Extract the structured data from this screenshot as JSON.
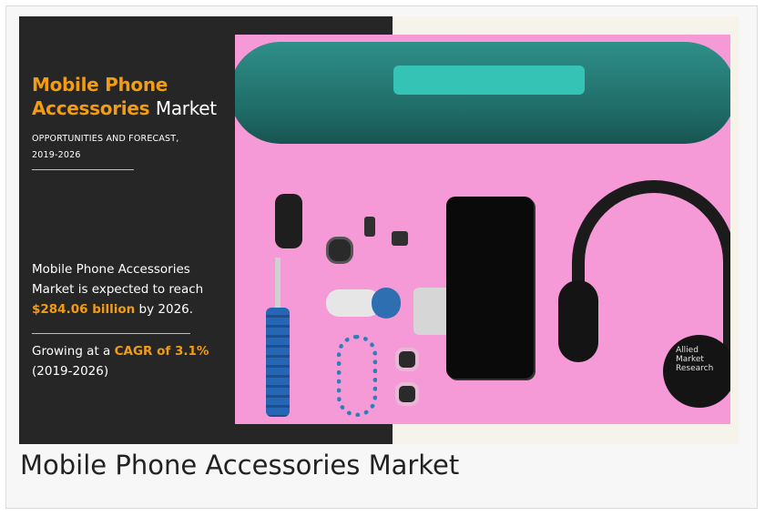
{
  "infographic": {
    "title_highlight_line1": "Mobile Phone",
    "title_highlight_line2": "Accessories",
    "title_plain": "Market",
    "subtitle_line1": "OPPORTUNITIES AND FORECAST,",
    "subtitle_line2": "2019-2026",
    "stat1_line1": "Mobile Phone Accessories",
    "stat1_line2": "Market is expected to reach",
    "stat1_value": "$284.06 billion",
    "stat1_suffix": "by 2026.",
    "stat2_prefix": "Growing at a",
    "stat2_value": "CAGR of 3.1%",
    "stat2_period": "(2019-2026)",
    "watermark_line1": "Allied",
    "watermark_line2": "Market",
    "watermark_line3": "Research",
    "accent_color": "#f39c12",
    "panel_color": "#262626",
    "photo_background_color": "#f59ad6"
  },
  "caption": {
    "text": "Mobile Phone Accessories Market"
  }
}
